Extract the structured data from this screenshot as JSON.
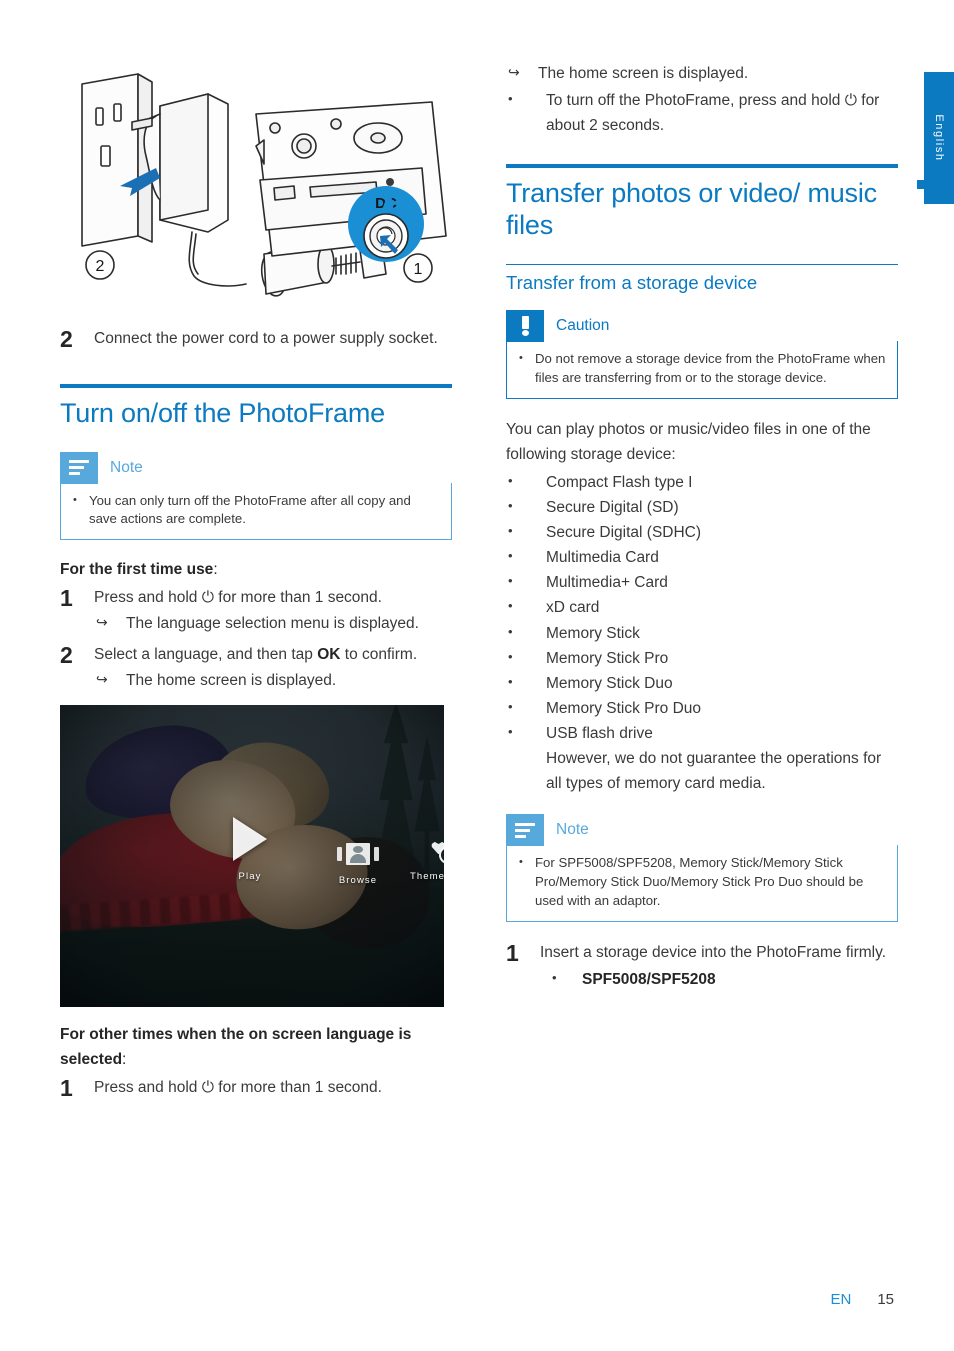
{
  "side_tab": {
    "language": "English"
  },
  "footer": {
    "lang_code": "EN",
    "page_number": "15"
  },
  "left_column": {
    "diagram": {
      "name": "power-connection-diagram",
      "callout_dc": "DC",
      "marker_1": "1",
      "marker_2": "2"
    },
    "step_2": {
      "number": "2",
      "text": "Connect the power cord to a power supply socket."
    },
    "heading": "Turn on/off the PhotoFrame",
    "note": {
      "title": "Note",
      "bullets": [
        "You can only turn off the PhotoFrame after all copy and save actions are complete."
      ]
    },
    "first_time_label": "For the first time use",
    "first_time_label_colon": ":",
    "steps": [
      {
        "number": "1",
        "text": "Press and hold ⏻ for more than 1 second.",
        "results": [
          "The language selection menu is displayed."
        ]
      },
      {
        "number": "2",
        "text_before": "Select a language, and then tap ",
        "text_bold": "OK",
        "text_after": " to confirm.",
        "results": [
          "The home screen is displayed."
        ]
      }
    ],
    "photo": {
      "name": "photoframe-home-screen",
      "menu": [
        {
          "icon": "play-icon",
          "label": "Play"
        },
        {
          "icon": "browse-icon",
          "label": "Browse"
        },
        {
          "icon": "theme-clock-icon",
          "label": "Theme Clock"
        }
      ]
    },
    "other_times_label": "For other times when the on screen language is selected",
    "other_times_label_colon": ":",
    "other_times_step": {
      "number": "1",
      "text": "Press and hold ⏻ for more than 1 second."
    }
  },
  "right_column": {
    "top_result": "The home screen is displayed.",
    "top_bullet": "To turn off the PhotoFrame, press and hold ⏻ for about 2 seconds.",
    "heading": "Transfer photos or video/ music files",
    "subheading": "Transfer from a storage device",
    "caution": {
      "title": "Caution",
      "bullets": [
        "Do not remove a storage device from the PhotoFrame when files are transferring from or to the storage device."
      ]
    },
    "intro": "You can play photos or music/video files in one of the following storage device:",
    "device_list": [
      "Compact Flash type I",
      "Secure Digital (SD)",
      "Secure Digital (SDHC)",
      "Multimedia Card",
      "Multimedia+ Card",
      "xD card",
      "Memory Stick",
      "Memory Stick Pro",
      "Memory Stick Duo",
      "Memory Stick Pro Duo",
      "USB flash drive"
    ],
    "device_list_note": "However, we do not guarantee the operations for all types of memory card media.",
    "note": {
      "title": "Note",
      "bullets": [
        "For SPF5008/SPF5208, Memory Stick/Memory Stick Pro/Memory Stick Duo/Memory Stick Pro Duo should be used with an adaptor."
      ]
    },
    "insert_step": {
      "number": "1",
      "text": "Insert a storage device into the PhotoFrame firmly.",
      "sub_bullet": "SPF5008/SPF5208"
    }
  },
  "colors": {
    "heading_blue": "#0b7ac0",
    "note_blue": "#57a9dc",
    "body_gray": "#3a3a3c",
    "footer_blue": "#1a8fd4"
  }
}
